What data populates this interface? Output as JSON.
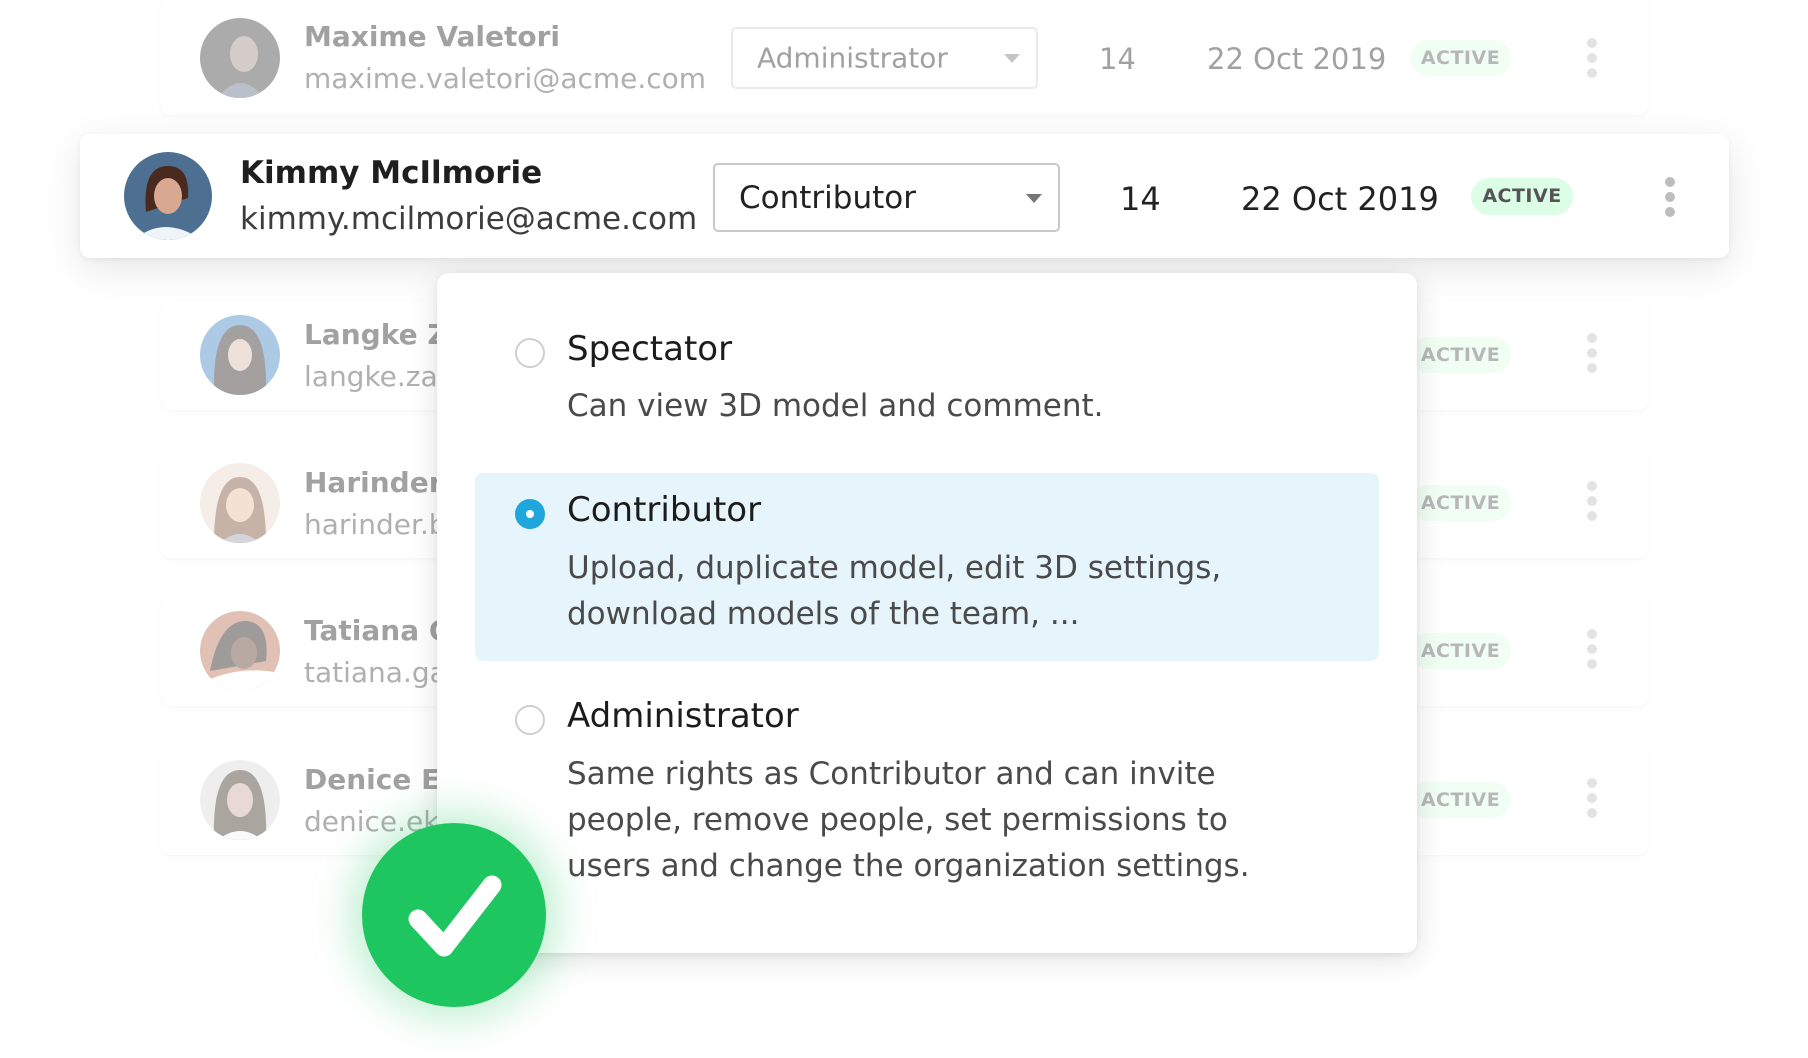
{
  "users": [
    {
      "name": "Maxime Valetori",
      "email": "maxime.valetori@acme.com",
      "role": "Administrator",
      "count": "14",
      "date": "22 Oct 2019",
      "status": "ACTIVE",
      "focused": false
    },
    {
      "name": "Kimmy McIlmorie",
      "email": "kimmy.mcilmorie@acme.com",
      "role": "Contributor",
      "count": "14",
      "date": "22 Oct 2019",
      "status": "ACTIVE",
      "focused": true
    },
    {
      "name": "Langke Za",
      "email": "langke.zar",
      "status": "ACTIVE",
      "focused": false
    },
    {
      "name": "Harinder I",
      "email": "harinder.b",
      "status": "ACTIVE",
      "focused": false
    },
    {
      "name": "Tatiana Ga",
      "email": "tatiana.ga",
      "status": "ACTIVE",
      "focused": false
    },
    {
      "name": "Denice Ek",
      "email": "denice.ekc",
      "status": "ACTIVE",
      "focused": false
    }
  ],
  "role_menu": {
    "selected": "Contributor",
    "options": [
      {
        "title": "Spectator",
        "description": "Can view 3D model and comment.",
        "selected": false
      },
      {
        "title": "Contributor",
        "description": "Upload, duplicate model, edit 3D settings, download models of the team, ...",
        "selected": true
      },
      {
        "title": "Administrator",
        "description": "Same rights as Contributor and can invite people, remove people, set permissions to users and change the organization settings.",
        "selected": false
      }
    ]
  },
  "icons": {
    "check": "check-circle-icon",
    "kebab": "more-vertical-icon",
    "caret": "caret-down-icon",
    "radio": "radio-icon"
  },
  "colors": {
    "success_green": "#1dc65f",
    "radio_blue": "#1fa6dc",
    "selected_bg": "#e6f4fb",
    "badge_bg": "#dcfde6"
  }
}
